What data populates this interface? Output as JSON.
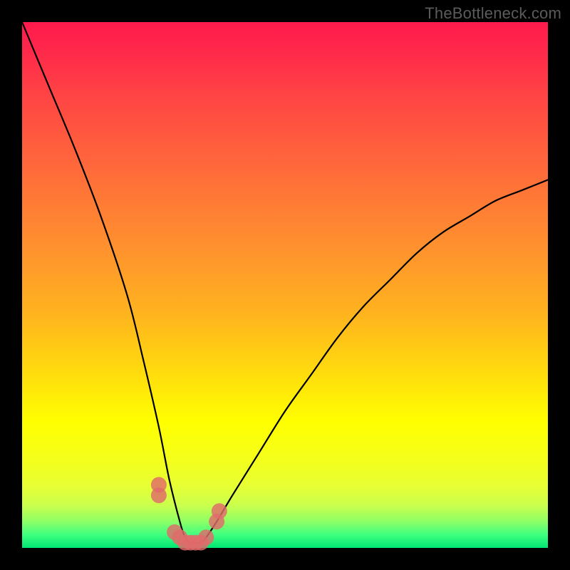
{
  "watermark": "TheBottleneck.com",
  "chart_data": {
    "type": "line",
    "title": "",
    "xlabel": "",
    "ylabel": "",
    "xlim": [
      0,
      100
    ],
    "ylim": [
      0,
      100
    ],
    "series": [
      {
        "name": "bottleneck-curve",
        "x": [
          0,
          5,
          10,
          15,
          20,
          23,
          26,
          28,
          30,
          31,
          32,
          33,
          34,
          35,
          37,
          40,
          45,
          50,
          55,
          60,
          65,
          70,
          75,
          80,
          85,
          90,
          95,
          100
        ],
        "values": [
          100,
          88,
          76,
          63,
          48,
          36,
          23,
          13,
          5,
          2,
          1,
          1,
          1,
          2,
          5,
          10,
          18,
          26,
          33,
          40,
          46,
          51,
          56,
          60,
          63,
          66,
          68,
          70
        ]
      },
      {
        "name": "markers",
        "x": [
          26,
          26,
          29,
          30,
          31,
          32,
          33,
          34,
          35,
          37,
          37.5
        ],
        "values": [
          10,
          12,
          3,
          2,
          1,
          1,
          1,
          1,
          2,
          5,
          7
        ]
      }
    ],
    "colors": {
      "curve_stroke": "#000000",
      "marker_fill": "#e06a6a",
      "gradient_top": "#ff1a4d",
      "gradient_bottom": "#00e673"
    }
  }
}
